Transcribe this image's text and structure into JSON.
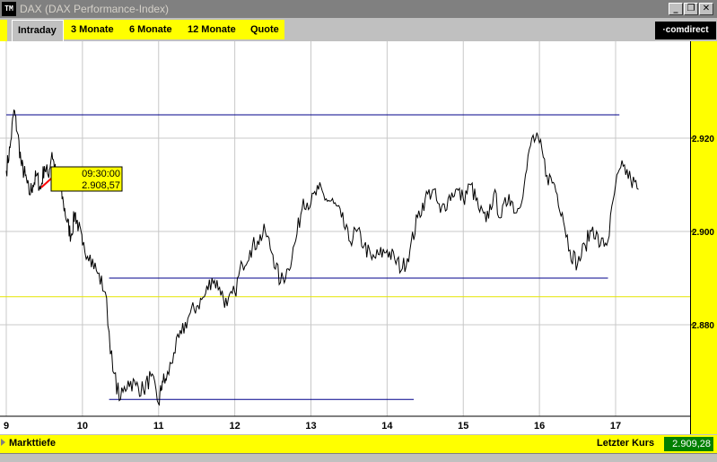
{
  "window": {
    "icon_text": "TM",
    "title": "DAX (DAX Performance-Index)",
    "minimize": "_",
    "restore": "❐",
    "close": "✕"
  },
  "tabs": [
    {
      "label": "Intraday",
      "active": true
    },
    {
      "label": "3 Monate"
    },
    {
      "label": "6 Monate"
    },
    {
      "label": "12 Monate"
    },
    {
      "label": "Quote"
    }
  ],
  "logo": "·comdirect",
  "tooltip": {
    "time": "09:30:00",
    "value": "2.908,57"
  },
  "bottom": {
    "markttiefe": "Markttiefe",
    "letzter_label": "Letzter Kurs",
    "letzter_value": "2.909,28"
  },
  "colors": {
    "accent": "#ffff00",
    "line": "#000000",
    "support": "#00008b",
    "reference": "#e6e600",
    "last_price_bg": "#008000"
  },
  "chart_data": {
    "type": "line",
    "x_ticks": [
      "9",
      "10",
      "11",
      "12",
      "13",
      "14",
      "15",
      "16",
      "17"
    ],
    "y_ticks": [
      "2.920",
      "2.900",
      "2.880"
    ],
    "ylim": [
      2860,
      2934
    ],
    "xlim": [
      9.0,
      18.0
    ],
    "grid": true,
    "series": [
      {
        "x": [
          9.0,
          9.05,
          9.1,
          9.15,
          9.2,
          9.25,
          9.3,
          9.35,
          9.4,
          9.45,
          9.5,
          9.55,
          9.6,
          9.65,
          9.7,
          9.75,
          9.8,
          9.85,
          9.9,
          9.95,
          10.0,
          10.1,
          10.2,
          10.3,
          10.4,
          10.5,
          10.6,
          10.7,
          10.8,
          10.9,
          11.0,
          11.05,
          11.1,
          11.2,
          11.3,
          11.4,
          11.5,
          11.6,
          11.7,
          11.8,
          11.9,
          12.0,
          12.1,
          12.2,
          12.3,
          12.4,
          12.5,
          12.6,
          12.7,
          12.8,
          12.9,
          13.0,
          13.1,
          13.2,
          13.3,
          13.4,
          13.5,
          13.6,
          13.7,
          13.8,
          13.9,
          14.0,
          14.1,
          14.2,
          14.3,
          14.4,
          14.5,
          14.6,
          14.7,
          14.8,
          14.9,
          15.0,
          15.1,
          15.2,
          15.3,
          15.4,
          15.5,
          15.6,
          15.7,
          15.8,
          15.9,
          16.0,
          16.1,
          16.2,
          16.3,
          16.4,
          16.5,
          16.6,
          16.7,
          16.8,
          16.9,
          17.0,
          17.1,
          17.2,
          17.3
        ],
        "y": [
          2913,
          2918,
          2926,
          2921,
          2914,
          2912,
          2908,
          2910,
          2912,
          2909,
          2914,
          2912,
          2917,
          2912,
          2910,
          2906,
          2902,
          2899,
          2904,
          2901,
          2897,
          2895,
          2891,
          2887,
          2870,
          2864,
          2868,
          2867,
          2866,
          2869,
          2863,
          2868,
          2868,
          2874,
          2878,
          2882,
          2884,
          2886,
          2890,
          2888,
          2884,
          2887,
          2893,
          2896,
          2898,
          2900,
          2895,
          2889,
          2892,
          2898,
          2907,
          2906,
          2909,
          2907,
          2906,
          2903,
          2898,
          2900,
          2897,
          2894,
          2895,
          2896,
          2894,
          2892,
          2896,
          2903,
          2907,
          2909,
          2904,
          2907,
          2909,
          2907,
          2910,
          2905,
          2902,
          2908,
          2903,
          2908,
          2904,
          2910,
          2920,
          2919,
          2912,
          2910,
          2904,
          2896,
          2893,
          2897,
          2901,
          2897,
          2898,
          2910,
          2914,
          2911,
          2909
        ]
      }
    ],
    "reference_lines": [
      {
        "y": 2925,
        "x0": 9.0,
        "x1": 17.05
      },
      {
        "y": 2890,
        "x0": 10.35,
        "x1": 16.9
      },
      {
        "y": 2864,
        "x0": 10.35,
        "x1": 14.35
      },
      {
        "y": 2886
      }
    ]
  }
}
